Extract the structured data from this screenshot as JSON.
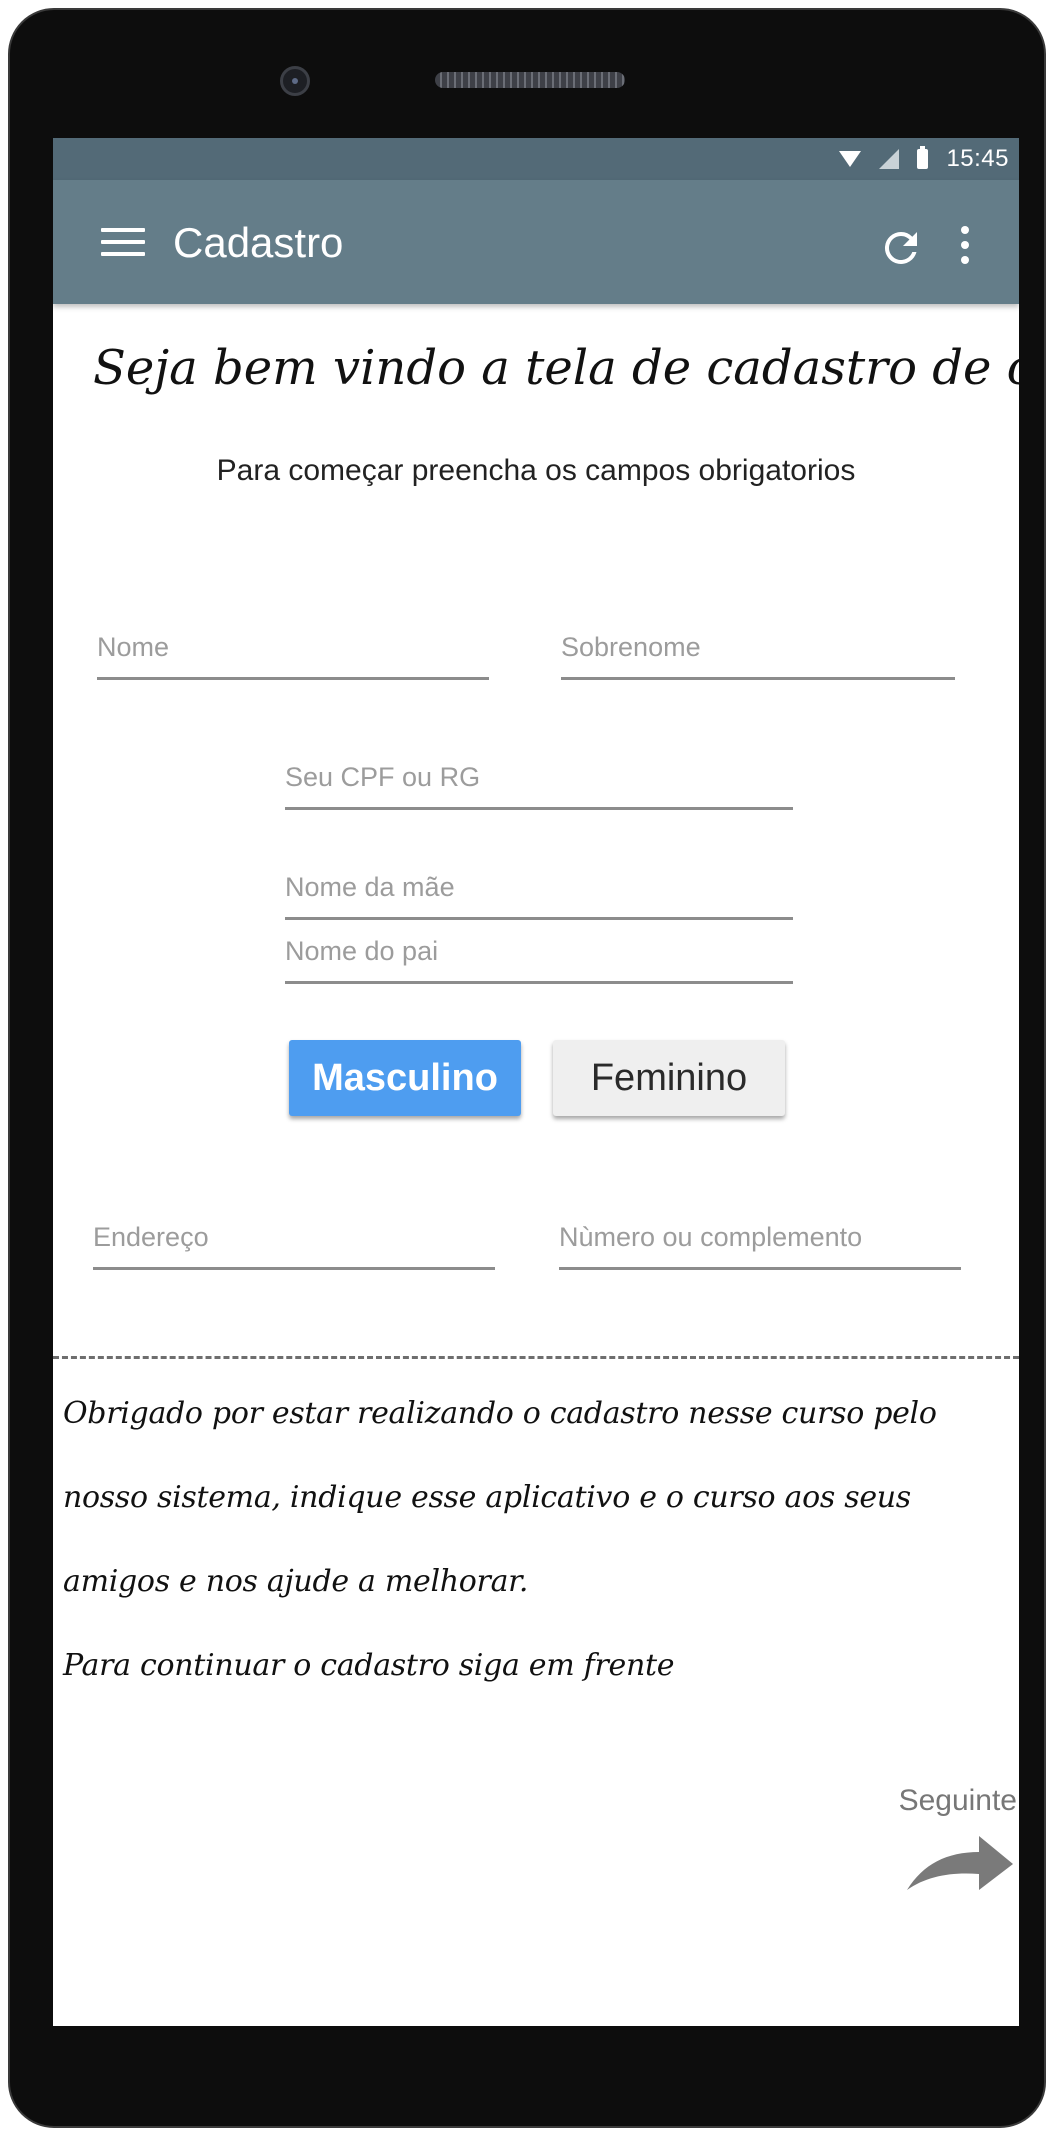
{
  "status_bar": {
    "time": "15:45"
  },
  "app_bar": {
    "title": "Cadastro"
  },
  "header": {
    "welcome": "Seja bem vindo a tela de cadastro de curso",
    "subtitle": "Para começar preencha os campos obrigatorios"
  },
  "form": {
    "nome": {
      "placeholder": "Nome",
      "value": ""
    },
    "sobrenome": {
      "placeholder": "Sobrenome",
      "value": ""
    },
    "documento": {
      "placeholder": "Seu CPF ou RG",
      "value": ""
    },
    "mae": {
      "placeholder": "Nome da mãe",
      "value": ""
    },
    "pai": {
      "placeholder": "Nome do pai",
      "value": ""
    },
    "endereco": {
      "placeholder": "Endereço",
      "value": ""
    },
    "numero": {
      "placeholder": "Nùmero ou complemento",
      "value": ""
    }
  },
  "gender": {
    "male_label": "Masculino",
    "female_label": "Feminino",
    "selected": "Masculino"
  },
  "message": {
    "line1": "Obrigado por estar realizando o cadastro nesse curso pelo",
    "line2": "nosso sistema, indique esse aplicativo e o curso aos seus",
    "line3": "amigos e nos ajude a melhorar.",
    "line4": "Para continuar o cadastro siga em frente"
  },
  "navigation": {
    "next_label": "Seguinte"
  },
  "icons": {
    "menu": "menu-icon",
    "refresh": "refresh-icon",
    "more": "more-vert-icon",
    "next": "forward-arrow-icon",
    "wifi": "wifi-icon",
    "signal": "signal-icon",
    "battery": "battery-icon"
  },
  "colors": {
    "status_bar": "#536a77",
    "app_bar": "#647d89",
    "primary_button": "#4e9df0",
    "secondary_button": "#efefef"
  }
}
